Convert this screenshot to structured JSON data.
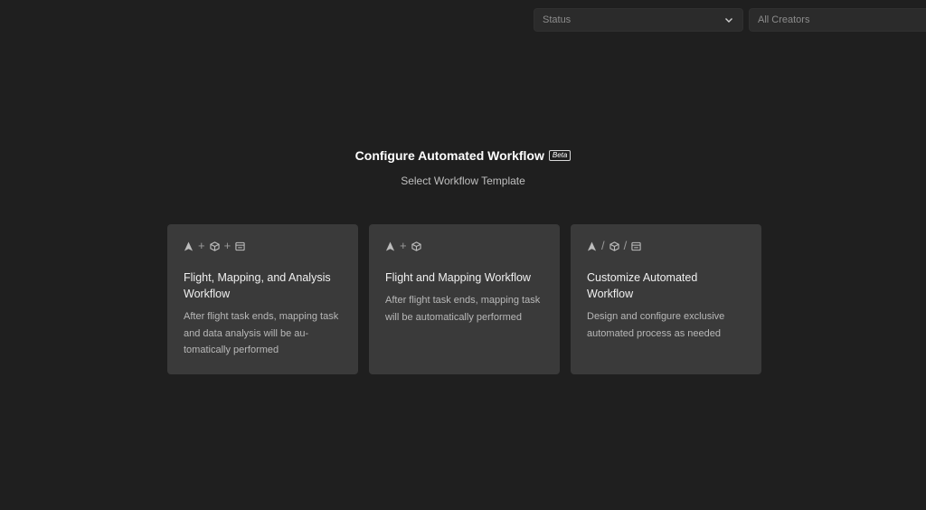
{
  "filters": {
    "status_placeholder": "Status",
    "creators_placeholder": "All Creators"
  },
  "header": {
    "title": "Configure Automated Workflow",
    "badge": "Beta",
    "subtitle": "Select Workflow Template"
  },
  "cards": [
    {
      "icons": [
        "flight-icon",
        "plus",
        "mapping-icon",
        "plus",
        "analysis-icon"
      ],
      "title": "Flight, Mapping, and Analysis Workflow",
      "description": "After flight task ends, mapping task and data analysis will be au-tomatically performed"
    },
    {
      "icons": [
        "flight-icon",
        "plus",
        "mapping-icon"
      ],
      "title": "Flight and Mapping Workflow",
      "description": "After flight task ends, mapping task will be automatically performed"
    },
    {
      "icons": [
        "flight-icon",
        "slash",
        "mapping-icon",
        "slash",
        "analysis-icon"
      ],
      "title": "Customize Automated Workflow",
      "description": "Design and configure exclusive automated process as needed"
    }
  ],
  "colors": {
    "background": "#1f1f1f",
    "card": "#3a3a3a",
    "text_primary": "#ffffff",
    "text_secondary": "#b8b8b8"
  }
}
